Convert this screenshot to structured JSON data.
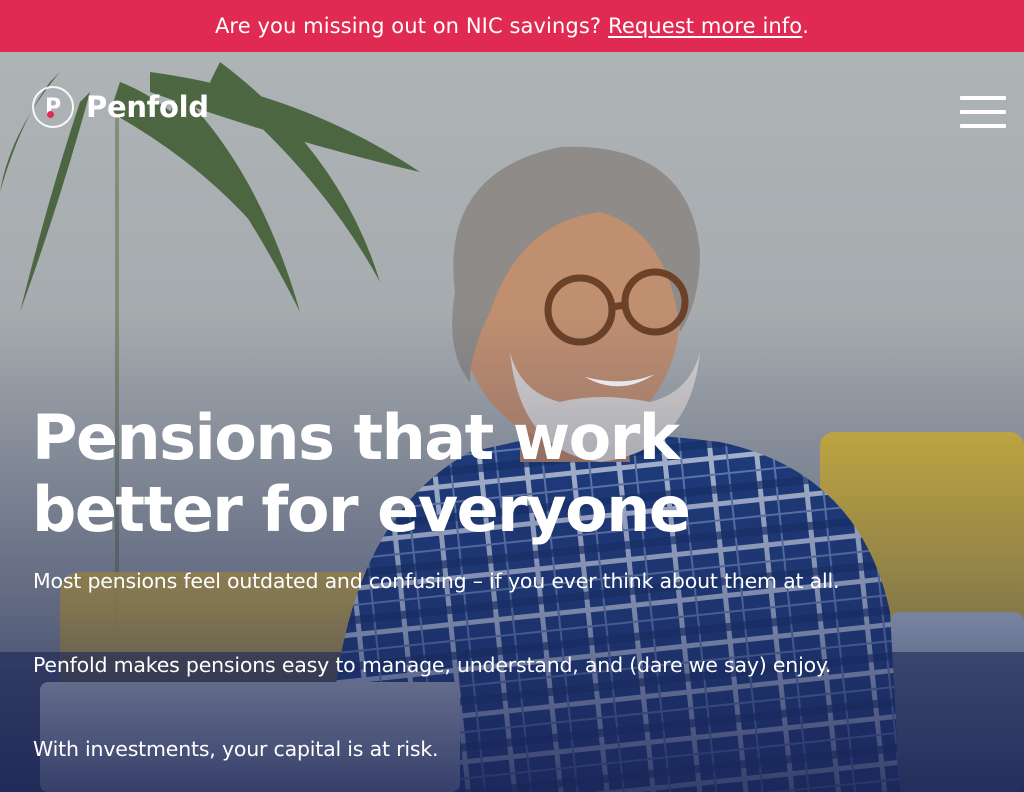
{
  "banner": {
    "text": "Are you missing out on NIC savings?",
    "link": "Request more info",
    "suffix": ".",
    "color": "#e02a52"
  },
  "header": {
    "logo_letter": "P",
    "logo_text": "Penfold",
    "menu_icon": "hamburger-menu-icon"
  },
  "hero": {
    "headline_line1": "Pensions that work",
    "headline_line2": "better for everyone",
    "paragraph1": "Most pensions feel outdated and confusing – if you ever think about them at all.",
    "paragraph2": "Penfold makes pensions easy to manage, understand, and (dare we say) enjoy.",
    "paragraph3": "With investments, your capital is at risk."
  }
}
